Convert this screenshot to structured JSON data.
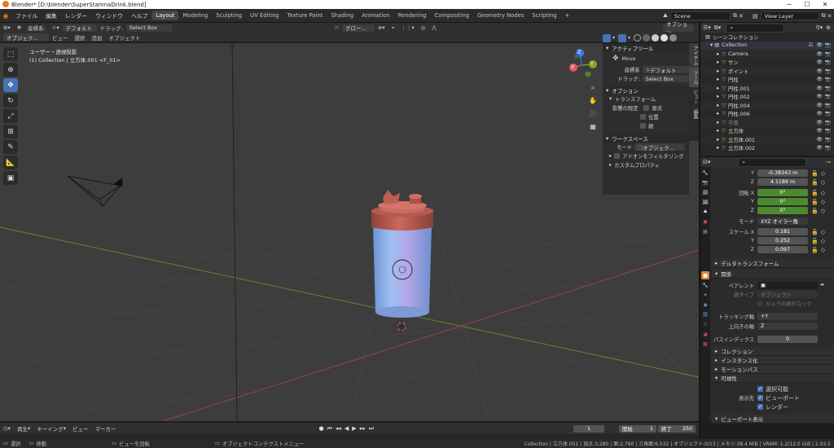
{
  "window": {
    "title": "Blender* [D:\\blender\\SuperStamnaDrink.blend]"
  },
  "menu": [
    "ファイル",
    "編集",
    "レンダー",
    "ウィンドウ",
    "ヘルプ"
  ],
  "workspaces": [
    "Layout",
    "Modeling",
    "Sculpting",
    "UV Editing",
    "Texture Paint",
    "Shading",
    "Animation",
    "Rendering",
    "Compositing",
    "Geometry Nodes",
    "Scripting"
  ],
  "active_workspace": "Layout",
  "scene": "Scene",
  "view_layer": "View Layer",
  "header": {
    "orientation_label": "座標系:",
    "orientation_value": "デフォルト",
    "drag_label": "ドラッグ:",
    "drag_value": "Select Box",
    "global_value": "グロー...",
    "options": "オプション",
    "mode": "オブジェク...",
    "view": "ビュー",
    "select": "選択",
    "add": "追加",
    "object": "オブジェクト"
  },
  "viewport": {
    "info_line1": "ユーザー・透視投影",
    "info_line2": "(1) Collection | 立方体.001 <F_01>",
    "axis_x": "X",
    "axis_y": "Y",
    "axis_z": "Z"
  },
  "npanel": {
    "active_tool": "アクティブツール",
    "move": "Move",
    "coord_label": "座標系",
    "coord_value": "デフォルト",
    "drag_label": "ドラッグ:",
    "drag_value": "Select Box",
    "options": "オプション",
    "transform": "トランスフォーム",
    "affect_only": "影響の限定",
    "origin": "原点",
    "location": "位置",
    "parents": "親",
    "workspace": "ワークスペース",
    "mode_label": "モード",
    "mode_value": "オブジェク...",
    "addon_filter": "アドオンをフィルタリング",
    "custom_props": "カスタムプロパティ",
    "tabs": [
      "アイテム",
      "ツール",
      "ビュー",
      "編集"
    ]
  },
  "outliner": {
    "search_placeholder": "",
    "scene_collection": "シーンコレクション",
    "collection": "Collection",
    "items": [
      {
        "name": "Camera",
        "color": "#e0944b"
      },
      {
        "name": "サン",
        "color": "#e0944b"
      },
      {
        "name": "ポイント",
        "color": "#e0944b"
      },
      {
        "name": "円柱",
        "color": "#e0944b"
      },
      {
        "name": "円柱.001",
        "color": "#e0944b"
      },
      {
        "name": "円柱.002",
        "color": "#e0944b"
      },
      {
        "name": "円柱.004",
        "color": "#e0944b"
      },
      {
        "name": "円柱.006",
        "color": "#e0944b"
      },
      {
        "name": "平面",
        "color": "#888888"
      },
      {
        "name": "立方体",
        "color": "#e0944b"
      },
      {
        "name": "立方体.001",
        "color": "#e0944b"
      },
      {
        "name": "立方体.002",
        "color": "#e0944b"
      }
    ]
  },
  "properties": {
    "loc_y_label": "Y",
    "loc_y": "-0.38343 m",
    "loc_z_label": "Z",
    "loc_z": "4.1189 m",
    "rot_label": "回転 X",
    "rot_x": "0°",
    "rot_y_label": "Y",
    "rot_y": "0°",
    "rot_z_label": "Z",
    "rot_z": "0°",
    "mode_label": "モード",
    "mode_value": "XYZ オイラー角",
    "scale_label": "スケール X",
    "scale_x": "0.181",
    "scale_y_label": "Y",
    "scale_y": "0.252",
    "scale_z_label": "Z",
    "scale_z": "0.097",
    "delta": "デルタトランスフォーム",
    "relations": "関係",
    "parent_label": "ペアレント",
    "parent_type_label": "親タイプ",
    "parent_type_value": "オブジェクト",
    "camera_lock": "カメラの親をロック",
    "tracking_label": "トラッキング軸",
    "tracking_value": "+Y",
    "up_label": "上向きの軸",
    "up_value": "Z",
    "pass_label": "パスインデックス",
    "pass_value": "0",
    "collections": "コレクション",
    "instancing": "インスタンス化",
    "motion_paths": "モーションパス",
    "visibility": "可視性",
    "selectable": "選択可能",
    "show_in_label": "表示先",
    "show_viewport": "ビューポート",
    "show_render": "レンダー",
    "viewport_display": "ビューポート表示"
  },
  "timeline": {
    "playback": "再生",
    "keying": "キーイング",
    "view": "ビュー",
    "marker": "マーカー",
    "current_frame": "1",
    "start_label": "開始",
    "start": "1",
    "end_label": "終了",
    "end": "250"
  },
  "status": {
    "select": "選択",
    "move": "移動",
    "rotate_view": "ビューを回転",
    "context_menu": "オブジェクトコンテクストメニュー",
    "stats": "Collection | 立方体.001 | 頂点:3,280 | 面:2,790 | 三角面:6,532 | オブジェクト:0/13 | メモリ:38.4 MiB | VRAM: 1.2/12.0 GiB | 2.93.5"
  },
  "colors": {
    "accent": "#4772b3",
    "bottle_lid": "#c4655a",
    "bottle_body": "#8fb4ea",
    "green": "#4c8a2f"
  }
}
